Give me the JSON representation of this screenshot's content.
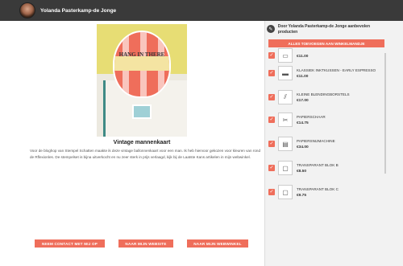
{
  "header": {
    "name": "Yolanda Pasterkamp-de Jonge"
  },
  "main": {
    "photo_text": "HANG IN THERE",
    "title": "Vintage mannenkaart",
    "description": "Voor de bloghop van Stempel Schatten maakte ik deze vintage ballonnenkaart voor een man. Ik heb hiervoor gekozen voor kleuren van rond de Rflexionles. De stempelset is bijna uitverkocht en nu zeer sterk in prijs verlaagd, kijk bij de Laatste Kans artikelen in mijn webwinkel.",
    "buttons": [
      "NEEM CONTACT MET MIJ OP",
      "NAAR MIJN WEBSITE",
      "NAAR MIJN WEBWINKEL"
    ]
  },
  "sidebar": {
    "heading": "Door Yolanda Pasterkamp-de Jonge aanbevolen producten",
    "add_all": "ALLES TOEVOEGEN AAN WINKELMANDJE",
    "items": [
      {
        "name": "",
        "price": "€11.00",
        "icon": "cushion-icon"
      },
      {
        "name": "KLASSIEK INKTKUSSEN - EARLY ESPRESSO",
        "price": "€11.00",
        "icon": "ink-pad-icon"
      },
      {
        "name": "KLEINE BLENDINGBORSTELS",
        "price": "€17.00",
        "icon": "brush-icon"
      },
      {
        "name": "PAPIERSCHAAR",
        "price": "€14.75",
        "icon": "scissors-icon"
      },
      {
        "name": "PAPIERSNIJMACHINE",
        "price": "€34.00",
        "icon": "paper-trimmer-icon"
      },
      {
        "name": "TRANSPARANT BLOK B",
        "price": "€8.50",
        "icon": "block-icon"
      },
      {
        "name": "TRANSPARANT BLOK C",
        "price": "€9.75",
        "icon": "block-icon"
      }
    ]
  }
}
